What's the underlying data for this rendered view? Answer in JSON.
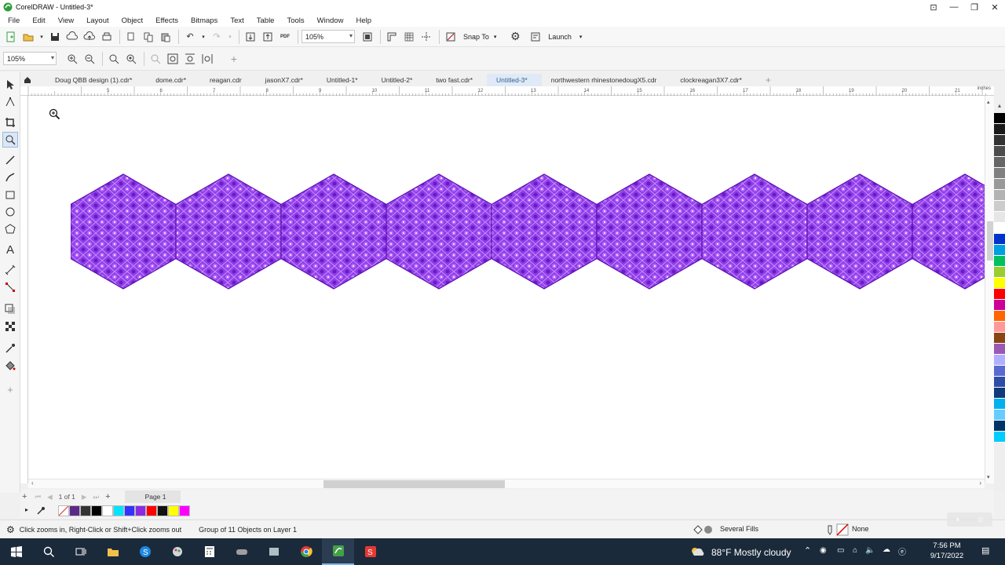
{
  "window": {
    "title": "CorelDRAW - Untitled-3*",
    "minimize_label": "—",
    "restore_label": "❐",
    "close_label": "✕"
  },
  "menu": [
    "File",
    "Edit",
    "View",
    "Layout",
    "Object",
    "Effects",
    "Bitmaps",
    "Text",
    "Table",
    "Tools",
    "Window",
    "Help"
  ],
  "toolbar": {
    "zoom_value": "105%",
    "snap_to_label": "Snap To",
    "launch_label": "Launch"
  },
  "propertybar": {
    "zoom_value": "105%"
  },
  "tabs": [
    {
      "label": "Doug QBB design (1).cdr*",
      "active": false
    },
    {
      "label": "dome.cdr*",
      "active": false
    },
    {
      "label": "reagan.cdr",
      "active": false
    },
    {
      "label": "jasonX7.cdr*",
      "active": false
    },
    {
      "label": "Untitled-1*",
      "active": false
    },
    {
      "label": "Untitled-2*",
      "active": false
    },
    {
      "label": "two fast.cdr*",
      "active": false
    },
    {
      "label": "Untitled-3*",
      "active": true
    },
    {
      "label": "northwestern rhinestonedougX5.cdr",
      "active": false
    },
    {
      "label": "clockreagan3X7.cdr*",
      "active": false
    }
  ],
  "ruler": {
    "unit": "inches",
    "numbers": [
      "5",
      "6",
      "7",
      "8",
      "9",
      "10",
      "11",
      "12",
      "13",
      "14",
      "15",
      "16",
      "17",
      "18",
      "19",
      "20",
      "21",
      "22",
      "23",
      "24"
    ]
  },
  "page_nav": {
    "page_count": "1 of 1",
    "page_tab": "Page 1"
  },
  "status": {
    "hint": "Click zooms in, Right-Click or Shift+Click zooms out",
    "selection": "Group of 11 Objects on Layer 1",
    "fill": "Several Fills",
    "outline": "None"
  },
  "taskbar": {
    "weather": "88°F  Mostly cloudy",
    "time": "7:56 PM",
    "date": "9/17/2022"
  },
  "colors": {
    "artwork_fill": "#8a2be2",
    "artwork_light": "#c07cf3",
    "artwork_dark": "#5d0fb0",
    "palette": [
      "#000000",
      "#1a1a1a",
      "#333333",
      "#4d4d4d",
      "#666666",
      "#808080",
      "#999999",
      "#b3b3b3",
      "#cccccc",
      "#e6e6e6",
      "#ffffff",
      "#0033cc",
      "#00a0e0",
      "#00c060",
      "#9acd32",
      "#ffff00",
      "#ff0000",
      "#cc0099",
      "#ff6600",
      "#ff9999",
      "#8b4513",
      "#9b59b6",
      "#b0b0ff",
      "#5b6ad0",
      "#2e4da8",
      "#123a7a",
      "#00b0f0",
      "#66ccff",
      "#003366",
      "#00ccff"
    ],
    "doc_palette": [
      "#ffffff",
      "#5b2a86",
      "#333333",
      "#000000",
      "#ffffff",
      "#00e5ff",
      "#3333ff",
      "#8a2be2",
      "#ff0000",
      "#111111",
      "#ffff00",
      "#ff00ff"
    ]
  }
}
